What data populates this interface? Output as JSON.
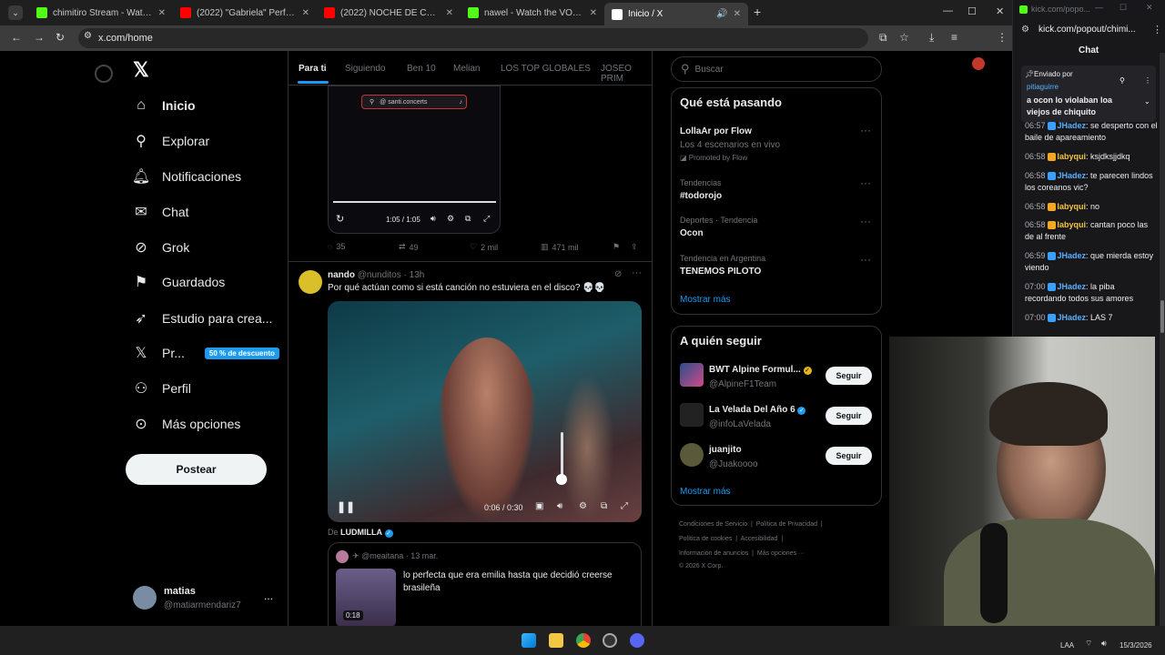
{
  "browser": {
    "tabs": [
      {
        "title": "chimitiro Stream - Watch Live o",
        "favicon": "kick-icon"
      },
      {
        "title": "(2022) \"Gabriela\" Performance",
        "favicon": "youtube-icon"
      },
      {
        "title": "(2022) NOCHE DE CHICAS CON",
        "favicon": "youtube-icon"
      },
      {
        "title": "nawel - Watch the VOD on Kick",
        "favicon": "kick-icon"
      },
      {
        "title": "Inicio / X",
        "favicon": "x-icon"
      }
    ],
    "url": "x.com/home"
  },
  "x_sidebar": {
    "items": [
      {
        "label": "Inicio",
        "icon": "home-icon"
      },
      {
        "label": "Explorar",
        "icon": "search-icon"
      },
      {
        "label": "Notificaciones",
        "icon": "bell-icon"
      },
      {
        "label": "Chat",
        "icon": "mail-icon"
      },
      {
        "label": "Grok",
        "icon": "grok-icon"
      },
      {
        "label": "Guardados",
        "icon": "bookmark-icon"
      },
      {
        "label": "Estudio para crea...",
        "icon": "rocket-icon"
      },
      {
        "label": "Pr...",
        "icon": "x-logo-icon"
      },
      {
        "label": "Perfil",
        "icon": "person-icon"
      },
      {
        "label": "Más opciones",
        "icon": "more-circle-icon"
      }
    ],
    "premium_badge": "50 % de descuento",
    "post_button": "Postear",
    "account": {
      "name": "matias",
      "handle": "@matiarmendariz7",
      "more": "..."
    }
  },
  "feed_tabs": [
    "Para ti",
    "Siguiendo",
    "Ben 10",
    "Melian",
    "LOS TOP GLOBALES",
    "JOSEO PRIM"
  ],
  "post1": {
    "overlay_label": "@ santi.concerts",
    "time": "1:05 / 1:05",
    "replies": "35",
    "reposts": "49",
    "likes": "2 mil",
    "views": "471 mil"
  },
  "post2": {
    "author": "nando",
    "handle": "@nunditos",
    "age": "· 13h",
    "text": "Por qué actúan como si está canción no estuviera en el disco? 💀💀",
    "video_time": "0:06 / 0:30",
    "from_prefix": "De",
    "from_name": "LUDMILLA",
    "quote": {
      "handle": "@meaitana",
      "age": "· 13 mar.",
      "text": "lo perfecta que era emilia hasta que decidió creerse brasileña",
      "duration": "0:18"
    }
  },
  "search": {
    "placeholder": "Buscar"
  },
  "trending": {
    "title": "Qué está pasando",
    "promo": {
      "name": "LollaAr por Flow",
      "sub": "Los 4 escenarios en vivo",
      "promoted": "Promoted by Flow"
    },
    "items": [
      {
        "context": "Tendencias",
        "name": "#todorojo"
      },
      {
        "context": "Deportes · Tendencia",
        "name": "Ocon"
      },
      {
        "context": "Tendencia en Argentina",
        "name": "TENEMOS PILOTO"
      }
    ],
    "more": "Mostrar más"
  },
  "who_to_follow": {
    "title": "A quién seguir",
    "accounts": [
      {
        "name": "BWT Alpine Formul...",
        "handle": "@AlpineF1Team",
        "button": "Seguir"
      },
      {
        "name": "La Velada Del Año 6",
        "handle": "@infoLaVelada",
        "button": "Seguir"
      },
      {
        "name": "juanjito",
        "handle": "@Juakoooo",
        "button": "Seguir"
      }
    ],
    "more": "Mostrar más"
  },
  "footer": {
    "line1": [
      "Condiciones de Servicio",
      "Política de Privacidad"
    ],
    "line2": [
      "Política de cookies",
      "Accesibilidad"
    ],
    "line3": [
      "Información de anuncios",
      "Más opciones ···"
    ],
    "copyright": "© 2026 X Corp."
  },
  "chat": {
    "popup_url": "kick.com/popo...",
    "url": "kick.com/popout/chimi...",
    "title": "Chat",
    "pinned": {
      "sent_by": "Enviado por",
      "user": "pitiaguirre",
      "text": "a ocon lo violaban loa viejos de chiquito"
    },
    "messages": [
      {
        "time": "06:57",
        "user": "JHadez",
        "text": ": se desperto con el baile de apareamiento",
        "badge": "b"
      },
      {
        "time": "06:58",
        "user": "labyqui",
        "text": ": ksjdksjjdkq",
        "badge": "y"
      },
      {
        "time": "06:58",
        "user": "JHadez",
        "text": ": te parecen lindos los coreanos vic?",
        "badge": "b"
      },
      {
        "time": "06:58",
        "user": "labyqui",
        "text": ": no",
        "badge": "y"
      },
      {
        "time": "06:58",
        "user": "labyqui",
        "text": ": cantan poco las de al frente",
        "badge": "y"
      },
      {
        "time": "06:59",
        "user": "JHadez",
        "text": ": que mierda estoy viendo",
        "badge": "b"
      },
      {
        "time": "07:00",
        "user": "JHadez",
        "text": ": la piba recordando todos sus amores",
        "badge": "b"
      },
      {
        "time": "07:00",
        "user": "JHadez",
        "text": ": LAS 7",
        "badge": "b"
      }
    ]
  },
  "taskbar": {
    "lang": "LAA",
    "date": "15/3/2026"
  },
  "colors": {
    "accent": "#1d9bf0",
    "kick_green": "#53fc18",
    "background": "#000000"
  }
}
